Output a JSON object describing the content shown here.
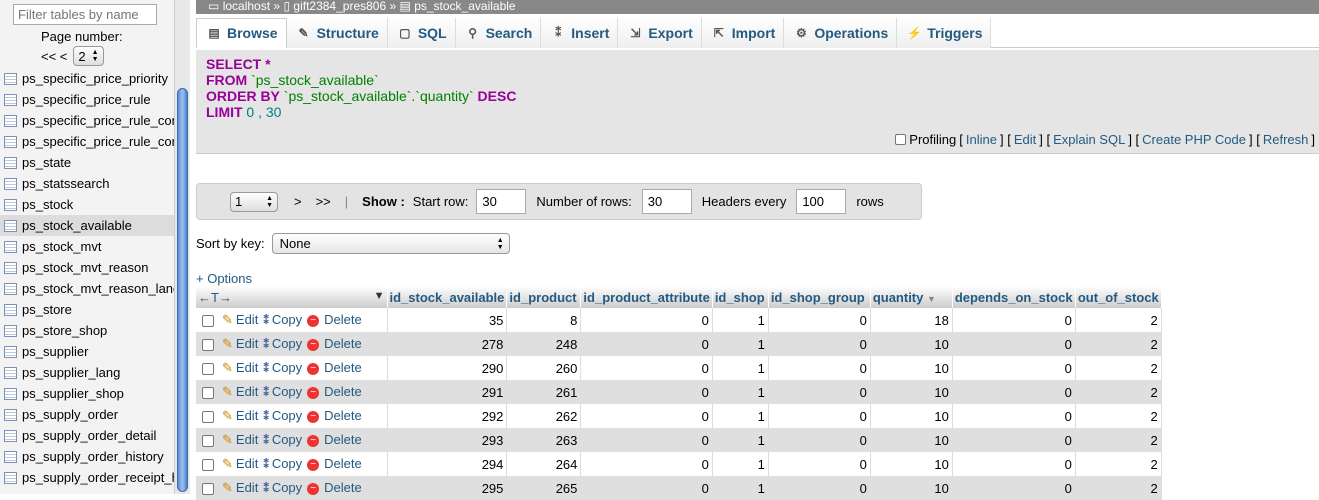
{
  "sidebar": {
    "filter_placeholder": "Filter tables by name",
    "page_label": "Page number:",
    "pager_prev": "<< <",
    "page_value": "2",
    "tables": [
      {
        "name": "ps_specific_price_priority",
        "active": false
      },
      {
        "name": "ps_specific_price_rule",
        "active": false
      },
      {
        "name": "ps_specific_price_rule_condition",
        "active": false
      },
      {
        "name": "ps_specific_price_rule_condition_group",
        "active": false
      },
      {
        "name": "ps_state",
        "active": false
      },
      {
        "name": "ps_statssearch",
        "active": false
      },
      {
        "name": "ps_stock",
        "active": false
      },
      {
        "name": "ps_stock_available",
        "active": true
      },
      {
        "name": "ps_stock_mvt",
        "active": false
      },
      {
        "name": "ps_stock_mvt_reason",
        "active": false
      },
      {
        "name": "ps_stock_mvt_reason_lang",
        "active": false
      },
      {
        "name": "ps_store",
        "active": false
      },
      {
        "name": "ps_store_shop",
        "active": false
      },
      {
        "name": "ps_supplier",
        "active": false
      },
      {
        "name": "ps_supplier_lang",
        "active": false
      },
      {
        "name": "ps_supplier_shop",
        "active": false
      },
      {
        "name": "ps_supply_order",
        "active": false
      },
      {
        "name": "ps_supply_order_detail",
        "active": false
      },
      {
        "name": "ps_supply_order_history",
        "active": false
      },
      {
        "name": "ps_supply_order_receipt_history",
        "active": false
      }
    ]
  },
  "breadcrumb": {
    "server": "localhost",
    "sep": "»",
    "database": "gift2384_pres806",
    "table": "ps_stock_available"
  },
  "tabs": [
    {
      "label": "Browse",
      "icon": "browse-icon",
      "glyph": "▤"
    },
    {
      "label": "Structure",
      "icon": "structure-icon",
      "glyph": "✎"
    },
    {
      "label": "SQL",
      "icon": "sql-icon",
      "glyph": "▢"
    },
    {
      "label": "Search",
      "icon": "search-icon",
      "glyph": "⚲"
    },
    {
      "label": "Insert",
      "icon": "insert-icon",
      "glyph": "⁑"
    },
    {
      "label": "Export",
      "icon": "export-icon",
      "glyph": "⇲"
    },
    {
      "label": "Import",
      "icon": "import-icon",
      "glyph": "⇱"
    },
    {
      "label": "Operations",
      "icon": "operations-icon",
      "glyph": "⚙"
    },
    {
      "label": "Triggers",
      "icon": "triggers-icon",
      "glyph": "⚡"
    }
  ],
  "sql": {
    "select_kw": "SELECT",
    "select_rest": " *",
    "from_kw": "FROM",
    "from_table": " `ps_stock_available`",
    "order_kw": "ORDER BY",
    "order_col": " `ps_stock_available`.`quantity`",
    "order_dir": " DESC",
    "limit_kw": "LIMIT",
    "limit_vals": " 0 , 30"
  },
  "sql_links": {
    "profiling": "Profiling",
    "inline": "Inline",
    "edit": "Edit",
    "explain": "Explain SQL",
    "php": "Create PHP Code",
    "refresh": "Refresh"
  },
  "nav": {
    "page": "1",
    "next": ">",
    "last": ">>",
    "sep": "|",
    "show": "Show :",
    "start_label": "Start row:",
    "start_val": "30",
    "rows_label": "Number of rows:",
    "rows_val": "30",
    "headers_label": "Headers every",
    "headers_val": "100",
    "rows_suffix": "rows"
  },
  "sort": {
    "label": "Sort by key:",
    "value": "None"
  },
  "options_label": "+ Options",
  "grid": {
    "arrows": "←T→",
    "columns": [
      "id_stock_available",
      "id_product",
      "id_product_attribute",
      "id_shop",
      "id_shop_group",
      "quantity",
      "depends_on_stock",
      "out_of_stock"
    ],
    "actions": {
      "edit": "Edit",
      "copy": "Copy",
      "delete": "Delete"
    },
    "rows": [
      [
        "35",
        "8",
        "0",
        "1",
        "0",
        "18",
        "0",
        "2"
      ],
      [
        "278",
        "248",
        "0",
        "1",
        "0",
        "10",
        "0",
        "2"
      ],
      [
        "290",
        "260",
        "0",
        "1",
        "0",
        "10",
        "0",
        "2"
      ],
      [
        "291",
        "261",
        "0",
        "1",
        "0",
        "10",
        "0",
        "2"
      ],
      [
        "292",
        "262",
        "0",
        "1",
        "0",
        "10",
        "0",
        "2"
      ],
      [
        "293",
        "263",
        "0",
        "1",
        "0",
        "10",
        "0",
        "2"
      ],
      [
        "294",
        "264",
        "0",
        "1",
        "0",
        "10",
        "0",
        "2"
      ],
      [
        "295",
        "265",
        "0",
        "1",
        "0",
        "10",
        "0",
        "2"
      ]
    ]
  }
}
